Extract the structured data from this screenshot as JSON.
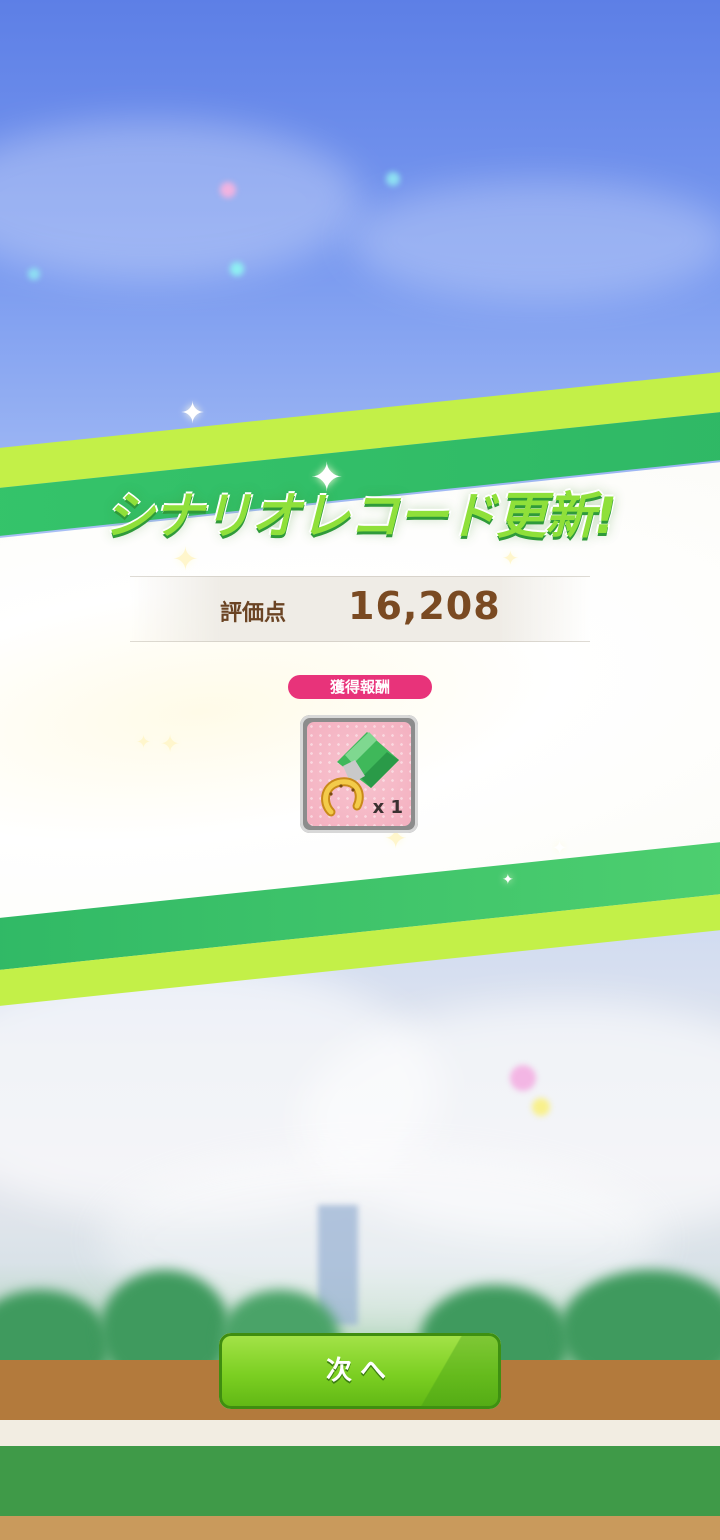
{
  "title": "シナリオレコード更新!",
  "score": {
    "label": "評価点",
    "value": "16,208"
  },
  "reward": {
    "label": "獲得報酬",
    "item_icon": "horseshoe-medal-icon",
    "quantity": "x 1"
  },
  "next_button": {
    "label": "次へ"
  },
  "colors": {
    "accent_green": "#8fe03a",
    "reward_pink": "#e8337a",
    "score_brown": "#7a4a22"
  }
}
